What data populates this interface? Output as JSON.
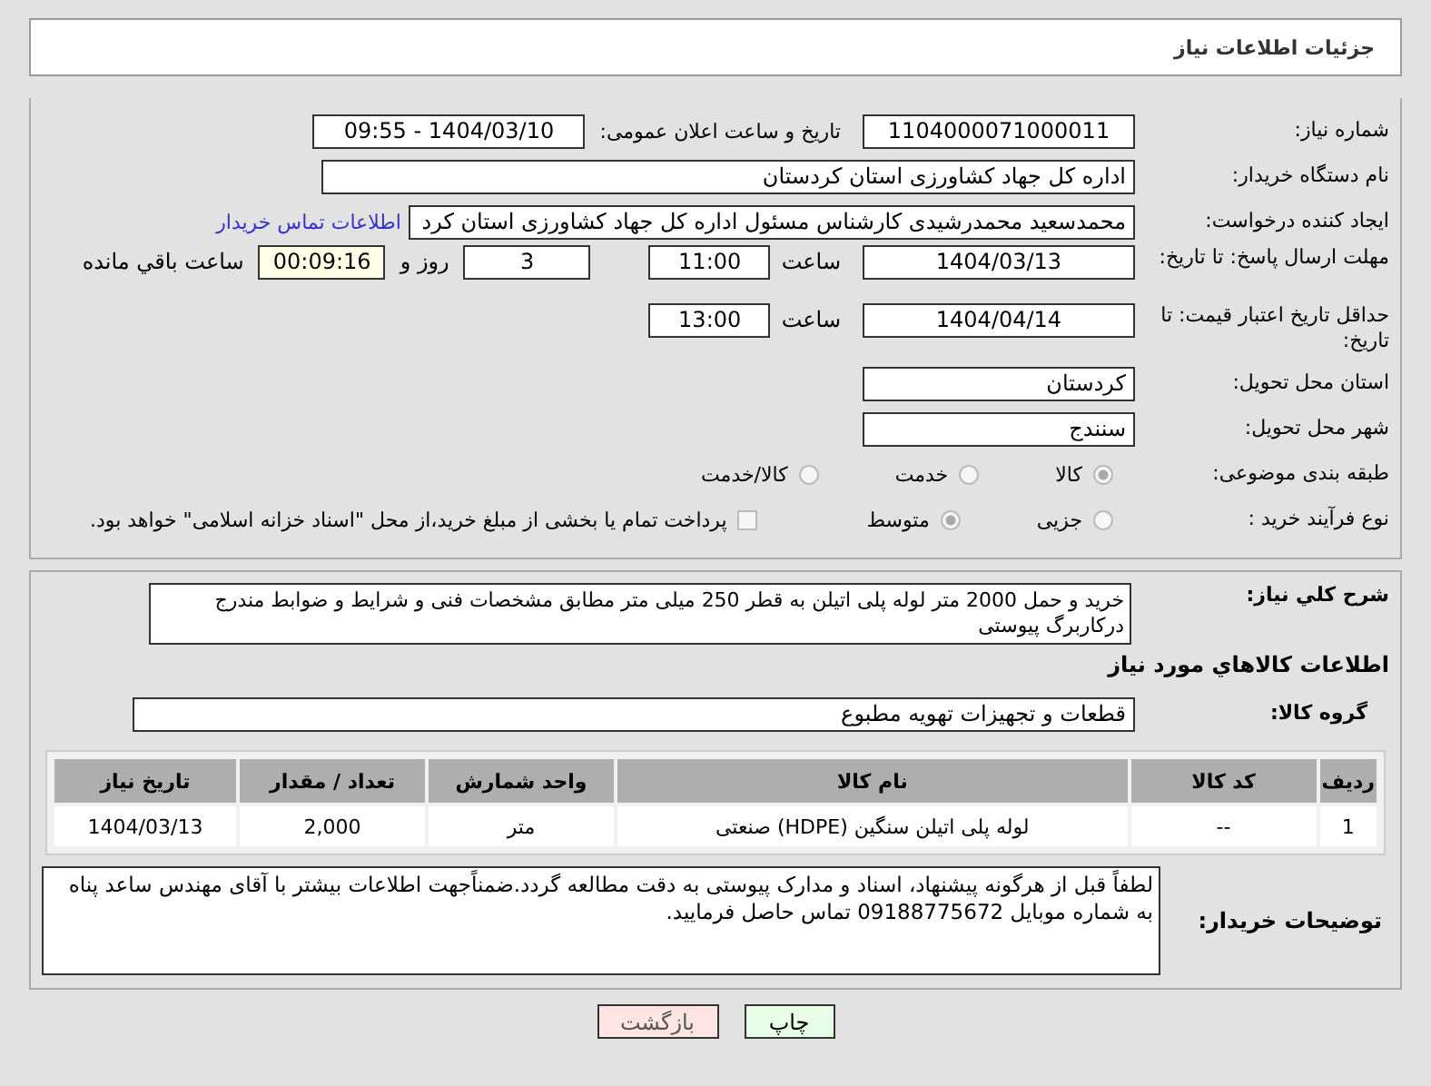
{
  "header": {
    "title": "جزئیات اطلاعات نیاز"
  },
  "fields": {
    "need_number": {
      "label": "شماره نیاز:",
      "value": "1104000071000011"
    },
    "announce": {
      "label": "تاریخ و ساعت اعلان عمومی:",
      "value": "1404/03/10 - 09:55"
    },
    "buyer": {
      "label": "نام دستگاه خریدار:",
      "value": "اداره کل جهاد کشاورزی استان کردستان"
    },
    "creator": {
      "label": "ایجاد کننده درخواست:",
      "value": "محمدسعید محمدرشیدی کارشناس مسئول اداره کل جهاد کشاورزی استان کرد",
      "link": "اطلاعات تماس خریدار"
    },
    "deadline": {
      "label": "مهلت ارسال پاسخ: تا تاریخ:",
      "date": "1404/03/13",
      "time_label": "ساعت",
      "time": "11:00",
      "days": "3",
      "days_label": "روز و",
      "remaining": "00:09:16",
      "remaining_label": "ساعت باقي مانده"
    },
    "validity": {
      "label": "حداقل تاریخ اعتبار قیمت: تا تاریخ:",
      "date": "1404/04/14",
      "time_label": "ساعت",
      "time": "13:00"
    },
    "province": {
      "label": "استان محل تحویل:",
      "value": "کردستان"
    },
    "city": {
      "label": "شهر محل تحویل:",
      "value": "سنندج"
    }
  },
  "category": {
    "label": "طبقه بندی موضوعی:",
    "options": [
      {
        "label": "کالا",
        "selected": true
      },
      {
        "label": "خدمت",
        "selected": false
      },
      {
        "label": "کالا/خدمت",
        "selected": false
      }
    ]
  },
  "process": {
    "label": "نوع فرآیند خرید :",
    "options": [
      {
        "label": "جزیی",
        "selected": false
      },
      {
        "label": "متوسط",
        "selected": true
      }
    ],
    "payment": {
      "checked": false,
      "text": "پرداخت تمام یا بخشی از مبلغ خرید،از محل \"اسناد خزانه اسلامی\" خواهد بود."
    }
  },
  "description": {
    "label": "شرح کلي نیاز:",
    "value": "خرید و حمل 2000 متر لوله پلی اتیلن به قطر 250 میلی متر مطابق مشخصات فنی  و شرایط و ضوابط مندرج درکاربرگ پیوستی"
  },
  "goods_title": "اطلاعات کالاهاي مورد نیاز",
  "goods_group": {
    "label": "گروه کالا:",
    "value": "قطعات و تجهیزات تهویه مطبوع"
  },
  "table": {
    "columns": [
      "ردیف",
      "کد کالا",
      "نام کالا",
      "واحد شمارش",
      "تعداد / مقدار",
      "تاریخ نیاز"
    ],
    "rows": [
      [
        "1",
        "--",
        "لوله پلی اتیلن سنگین (HDPE) صنعتی",
        "متر",
        "2,000",
        "1404/03/13"
      ]
    ]
  },
  "buyer_notes": {
    "label": "توضیحات خریدار:",
    "value": "لطفاً قبل از هرگونه پیشنهاد، اسناد و مدارک پیوستی به دقت مطالعه گردد.ضمناًجهت اطلاعات بیشتر با آقای مهندس ساعد پناه به شماره موبایل 09188775672 تماس حاصل فرمایید."
  },
  "buttons": [
    {
      "label": "چاپ",
      "kind": "print"
    },
    {
      "label": "بازگشت",
      "kind": "back"
    }
  ]
}
